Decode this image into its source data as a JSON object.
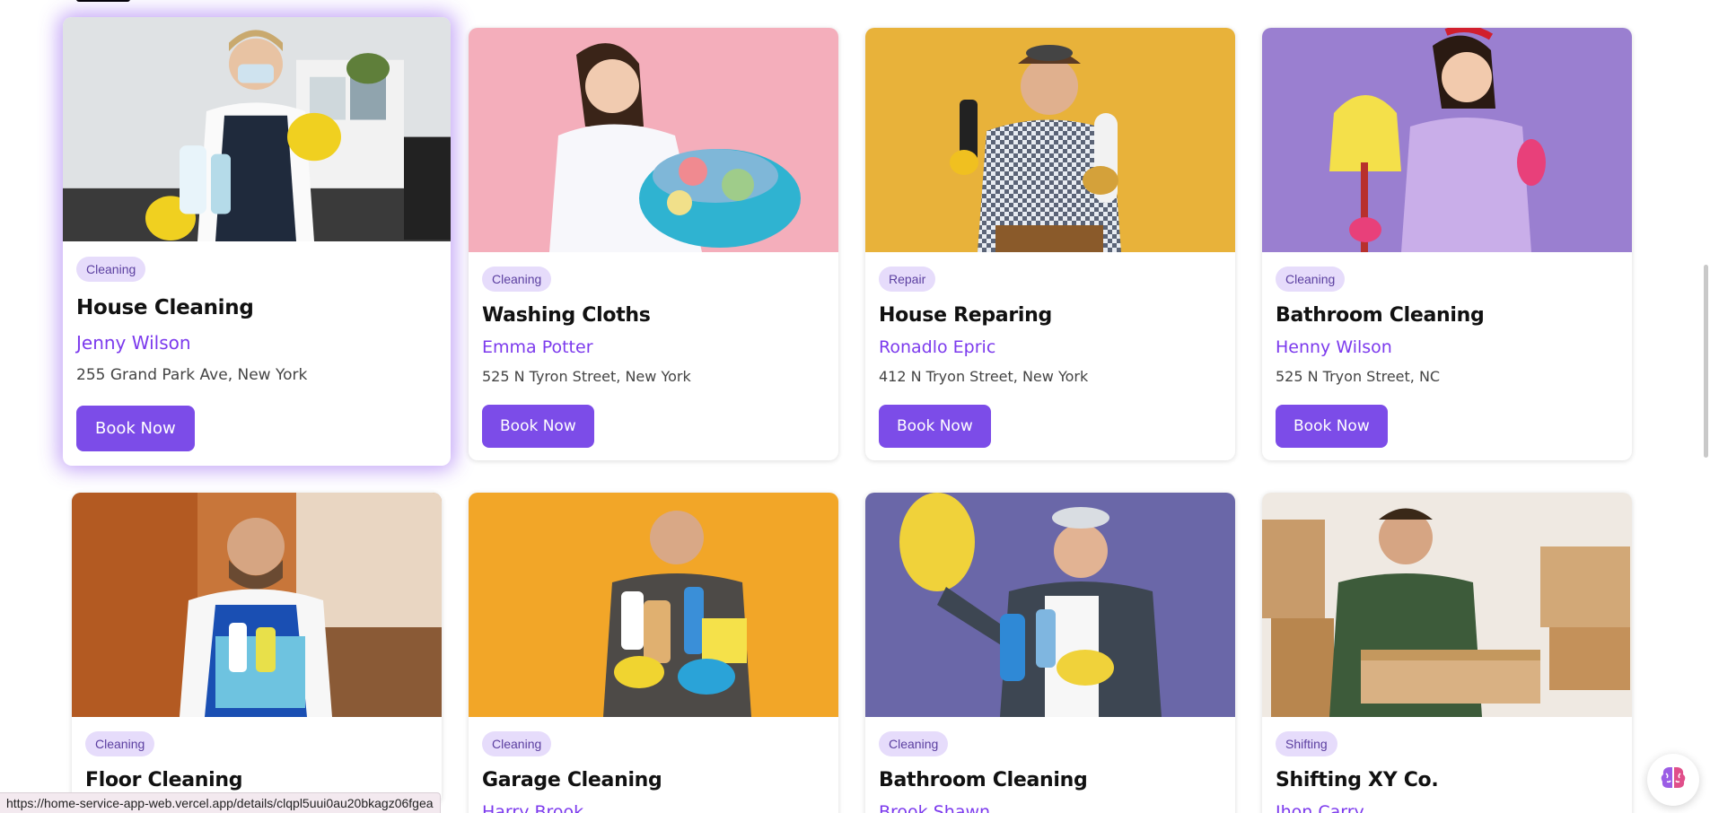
{
  "services": [
    {
      "category": "Cleaning",
      "title": "House Cleaning",
      "provider": "Jenny Wilson",
      "address": "255 Grand Park Ave, New York",
      "button": "Book Now",
      "image": "cleaner-thumbs-up-photo"
    },
    {
      "category": "Cleaning",
      "title": "Washing Cloths",
      "provider": "Emma Potter",
      "address": "525 N Tyron Street, New York",
      "button": "Book Now",
      "image": "woman-laundry-basket-photo"
    },
    {
      "category": "Repair",
      "title": "House Reparing",
      "provider": "Ronadlo Epric",
      "address": "412 N Tryon Street, New York",
      "button": "Book Now",
      "image": "handyman-drill-photo"
    },
    {
      "category": "Cleaning",
      "title": "Bathroom Cleaning",
      "provider": "Henny Wilson",
      "address": "525 N Tryon Street, NC",
      "button": "Book Now",
      "image": "woman-mop-photo"
    },
    {
      "category": "Cleaning",
      "title": "Floor Cleaning",
      "image": "man-cleaning-supplies-photo"
    },
    {
      "category": "Cleaning",
      "title": "Garage Cleaning",
      "provider": "Harry Brook",
      "image": "man-gloves-sprays-photo"
    },
    {
      "category": "Cleaning",
      "title": "Bathroom Cleaning",
      "provider": "Brook Shawn",
      "image": "man-stop-glove-photo"
    },
    {
      "category": "Shifting",
      "title": "Shifting XY Co.",
      "provider": "Jhon Carry",
      "image": "man-moving-boxes-photo"
    }
  ],
  "status_url": "https://home-service-app-web.vercel.app/details/clqpl5uui0au20bkagz06fgea",
  "colors": {
    "accent": "#7c4ce8",
    "chip_bg": "#e6dcfb",
    "provider_text": "#7c3aed"
  },
  "icons": {
    "assistant": "brain-icon"
  }
}
